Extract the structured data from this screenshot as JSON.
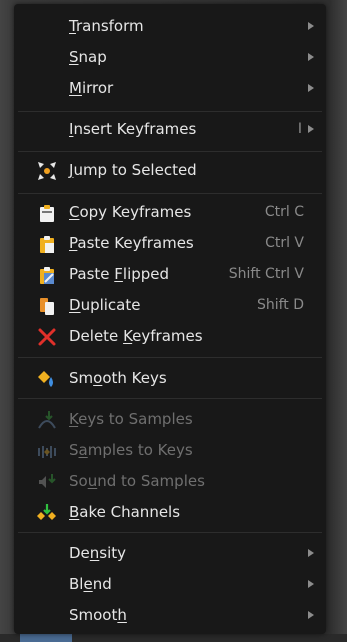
{
  "menu": {
    "items": [
      {
        "pre": "",
        "u": "T",
        "post": "ransform",
        "shortcut": "",
        "submenu": true,
        "icon": "",
        "disabled": false
      },
      {
        "pre": "",
        "u": "S",
        "post": "nap",
        "shortcut": "",
        "submenu": true,
        "icon": "",
        "disabled": false
      },
      {
        "pre": "",
        "u": "M",
        "post": "irror",
        "shortcut": "",
        "submenu": true,
        "icon": "",
        "disabled": false
      },
      {
        "pre": "",
        "u": "I",
        "post": "nsert Keyframes",
        "shortcut": "I",
        "submenu": true,
        "icon": "",
        "disabled": false
      },
      {
        "pre": "",
        "u": "J",
        "post": "ump to Selected",
        "shortcut": "",
        "submenu": false,
        "icon": "jump-to-selected-icon",
        "disabled": false
      },
      {
        "pre": "",
        "u": "C",
        "post": "opy Keyframes",
        "shortcut": "Ctrl C",
        "submenu": false,
        "icon": "copy-keyframes-icon",
        "disabled": false
      },
      {
        "pre": "",
        "u": "P",
        "post": "aste Keyframes",
        "shortcut": "Ctrl V",
        "submenu": false,
        "icon": "paste-keyframes-icon",
        "disabled": false
      },
      {
        "pre": "Paste ",
        "u": "F",
        "post": "lipped",
        "shortcut": "Shift Ctrl V",
        "submenu": false,
        "icon": "paste-flipped-icon",
        "disabled": false
      },
      {
        "pre": "",
        "u": "D",
        "post": "uplicate",
        "shortcut": "Shift D",
        "submenu": false,
        "icon": "duplicate-icon",
        "disabled": false
      },
      {
        "pre": "Delete ",
        "u": "K",
        "post": "eyframes",
        "shortcut": "",
        "submenu": false,
        "icon": "delete-keyframes-icon",
        "disabled": false
      },
      {
        "pre": "Sm",
        "u": "o",
        "post": "oth Keys",
        "shortcut": "",
        "submenu": false,
        "icon": "smooth-keys-icon",
        "disabled": false
      },
      {
        "pre": "",
        "u": "K",
        "post": "eys to Samples",
        "shortcut": "",
        "submenu": false,
        "icon": "keys-to-samples-icon",
        "disabled": true
      },
      {
        "pre": "S",
        "u": "a",
        "post": "mples to Keys",
        "shortcut": "",
        "submenu": false,
        "icon": "samples-to-keys-icon",
        "disabled": true
      },
      {
        "pre": "So",
        "u": "u",
        "post": "nd to Samples",
        "shortcut": "",
        "submenu": false,
        "icon": "sound-to-samples-icon",
        "disabled": true
      },
      {
        "pre": "",
        "u": "B",
        "post": "ake Channels",
        "shortcut": "",
        "submenu": false,
        "icon": "bake-channels-icon",
        "disabled": false
      },
      {
        "pre": "De",
        "u": "n",
        "post": "sity",
        "shortcut": "",
        "submenu": true,
        "icon": "",
        "disabled": false
      },
      {
        "pre": "Bl",
        "u": "e",
        "post": "nd",
        "shortcut": "",
        "submenu": true,
        "icon": "",
        "disabled": false
      },
      {
        "pre": "Smoot",
        "u": "h",
        "post": "",
        "shortcut": "",
        "submenu": true,
        "icon": "",
        "disabled": false
      }
    ]
  },
  "colors": {
    "menu_bg": "#181818",
    "text": "#e6e6e6",
    "disabled_text": "#6f6f6f",
    "shortcut": "#8a8a8a",
    "accent_tab": "#4a6b93"
  }
}
